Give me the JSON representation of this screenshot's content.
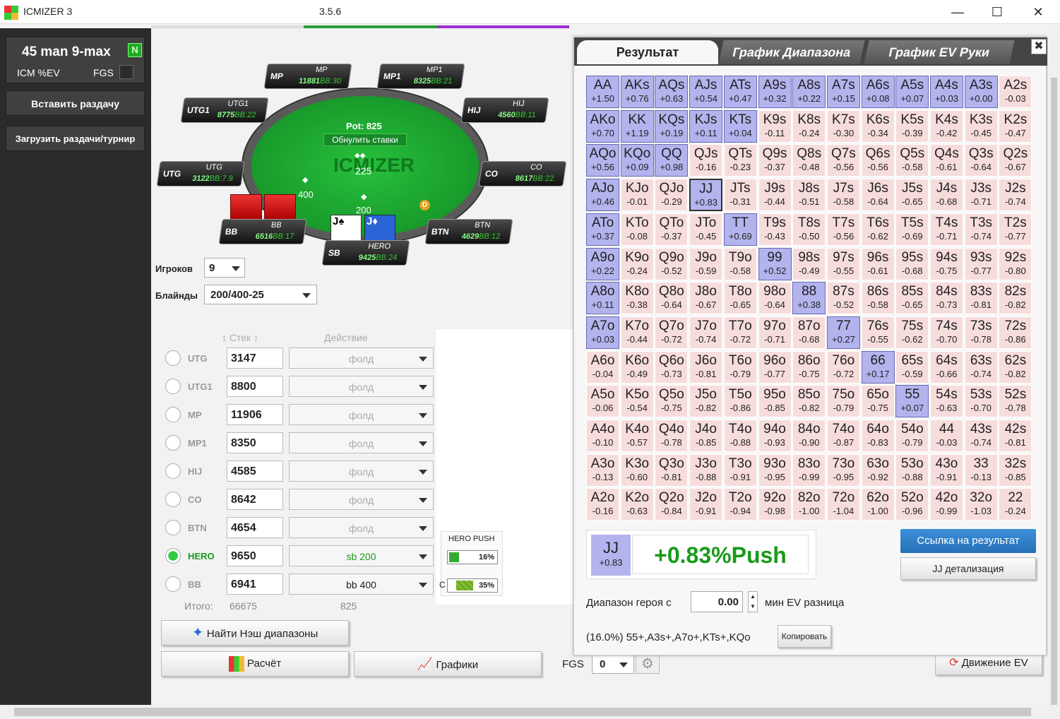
{
  "app": {
    "title": "ICMIZER 3",
    "version": "3.5.6",
    "minimize": "—",
    "maximize": "☐",
    "close": "✕"
  },
  "sidebar": {
    "tournament": "45 man 9-max",
    "tourn_badge": "N",
    "icm_label": "ICM %EV",
    "fgs_label": "FGS",
    "paste_btn": "Вставить раздачу",
    "load_btn": "Загрузить раздачи/турнир"
  },
  "table": {
    "pot": "Pot: 825",
    "reset": "Обнулить ставки",
    "logo": "ICMIZER",
    "center_bet": "225",
    "sb_bet": "200",
    "bb_bet": "400",
    "dealer": "D",
    "seats": [
      {
        "pos": "MP",
        "name": "MP",
        "stack": "11881",
        "bb": "30"
      },
      {
        "pos": "MP1",
        "name": "MP1",
        "stack": "8325",
        "bb": "21"
      },
      {
        "pos": "UTG1",
        "name": "UTG1",
        "stack": "8775",
        "bb": "22"
      },
      {
        "pos": "HIJ",
        "name": "HIJ",
        "stack": "4560",
        "bb": "11"
      },
      {
        "pos": "UTG",
        "name": "UTG",
        "stack": "3122",
        "bb": "7.9"
      },
      {
        "pos": "CO",
        "name": "CO",
        "stack": "8617",
        "bb": "22"
      },
      {
        "pos": "BB",
        "name": "BB",
        "stack": "6516",
        "bb": "17"
      },
      {
        "pos": "BTN",
        "name": "BTN",
        "stack": "4629",
        "bb": "12"
      },
      {
        "pos": "SB",
        "name": "HERO",
        "stack": "9425",
        "bb": "24"
      }
    ],
    "bb_prefix": "BB:",
    "hero_cards": [
      "J♠",
      "J♦"
    ]
  },
  "settings": {
    "players_label": "Игроков",
    "players_value": "9",
    "blinds_label": "Блайнды",
    "blinds_value": "200/400-25"
  },
  "players_header": {
    "stack": "Стек",
    "action": "Действие"
  },
  "players": [
    {
      "pos": "UTG",
      "stack": "3147",
      "action": "фолд"
    },
    {
      "pos": "UTG1",
      "stack": "8800",
      "action": "фолд"
    },
    {
      "pos": "MP",
      "stack": "11906",
      "action": "фолд"
    },
    {
      "pos": "MP1",
      "stack": "8350",
      "action": "фолд"
    },
    {
      "pos": "HIJ",
      "stack": "4585",
      "action": "фолд"
    },
    {
      "pos": "CO",
      "stack": "8642",
      "action": "фолд"
    },
    {
      "pos": "BTN",
      "stack": "4654",
      "action": "фолд"
    },
    {
      "pos": "HERO",
      "stack": "9650",
      "action": "sb 200"
    },
    {
      "pos": "BB",
      "stack": "6941",
      "action": "bb 400"
    }
  ],
  "totals": {
    "label": "Итого:",
    "stack": "66675",
    "action": "825"
  },
  "hero_push": {
    "title": "HERO PUSH",
    "push_pct": "16%",
    "call_label": "C",
    "call_pct": "35%"
  },
  "buttons": {
    "nash": "Найти Нэш диапазоны",
    "calc": "Расчёт",
    "charts": "Графики",
    "fgs_label": "FGS",
    "fgs_value": "0",
    "ev_move": "Движение EV"
  },
  "panel": {
    "tabs": [
      "Результат",
      "График Диапазона",
      "График EV Руки"
    ],
    "close": "✖",
    "selected_hand": {
      "hand": "JJ",
      "ev": "+0.83",
      "result": "+0.83%Push"
    },
    "link_btn": "Ссылка на результат",
    "detail_btn": "JJ детализация",
    "range_label": "Диапазон героя с",
    "range_value": "0.00",
    "range_suffix": "мин EV разница",
    "range_text": "(16.0%) 55+,A3s+,A7o+,KTs+,KQo",
    "copy_btn": "Копировать",
    "grid": [
      [
        [
          "AA",
          "+1.50"
        ],
        [
          "AKs",
          "+0.76"
        ],
        [
          "AQs",
          "+0.63"
        ],
        [
          "AJs",
          "+0.54"
        ],
        [
          "ATs",
          "+0.47"
        ],
        [
          "A9s",
          "+0.32"
        ],
        [
          "A8s",
          "+0.22"
        ],
        [
          "A7s",
          "+0.15"
        ],
        [
          "A6s",
          "+0.08"
        ],
        [
          "A5s",
          "+0.07"
        ],
        [
          "A4s",
          "+0.03"
        ],
        [
          "A3s",
          "+0.00"
        ],
        [
          "A2s",
          "-0.03"
        ]
      ],
      [
        [
          "AKo",
          "+0.70"
        ],
        [
          "KK",
          "+1.19"
        ],
        [
          "KQs",
          "+0.19"
        ],
        [
          "KJs",
          "+0.11"
        ],
        [
          "KTs",
          "+0.04"
        ],
        [
          "K9s",
          "-0.11"
        ],
        [
          "K8s",
          "-0.24"
        ],
        [
          "K7s",
          "-0.30"
        ],
        [
          "K6s",
          "-0.34"
        ],
        [
          "K5s",
          "-0.39"
        ],
        [
          "K4s",
          "-0.42"
        ],
        [
          "K3s",
          "-0.45"
        ],
        [
          "K2s",
          "-0.47"
        ]
      ],
      [
        [
          "AQo",
          "+0.56"
        ],
        [
          "KQo",
          "+0.09"
        ],
        [
          "QQ",
          "+0.98"
        ],
        [
          "QJs",
          "-0.16"
        ],
        [
          "QTs",
          "-0.23"
        ],
        [
          "Q9s",
          "-0.37"
        ],
        [
          "Q8s",
          "-0.48"
        ],
        [
          "Q7s",
          "-0.56"
        ],
        [
          "Q6s",
          "-0.56"
        ],
        [
          "Q5s",
          "-0.58"
        ],
        [
          "Q4s",
          "-0.61"
        ],
        [
          "Q3s",
          "-0.64"
        ],
        [
          "Q2s",
          "-0.67"
        ]
      ],
      [
        [
          "AJo",
          "+0.46"
        ],
        [
          "KJo",
          "-0.01"
        ],
        [
          "QJo",
          "-0.29"
        ],
        [
          "JJ",
          "+0.83"
        ],
        [
          "JTs",
          "-0.31"
        ],
        [
          "J9s",
          "-0.44"
        ],
        [
          "J8s",
          "-0.51"
        ],
        [
          "J7s",
          "-0.58"
        ],
        [
          "J6s",
          "-0.64"
        ],
        [
          "J5s",
          "-0.65"
        ],
        [
          "J4s",
          "-0.68"
        ],
        [
          "J3s",
          "-0.71"
        ],
        [
          "J2s",
          "-0.74"
        ]
      ],
      [
        [
          "ATo",
          "+0.37"
        ],
        [
          "KTo",
          "-0.08"
        ],
        [
          "QTo",
          "-0.37"
        ],
        [
          "JTo",
          "-0.45"
        ],
        [
          "TT",
          "+0.69"
        ],
        [
          "T9s",
          "-0.43"
        ],
        [
          "T8s",
          "-0.50"
        ],
        [
          "T7s",
          "-0.56"
        ],
        [
          "T6s",
          "-0.62"
        ],
        [
          "T5s",
          "-0.69"
        ],
        [
          "T4s",
          "-0.71"
        ],
        [
          "T3s",
          "-0.74"
        ],
        [
          "T2s",
          "-0.77"
        ]
      ],
      [
        [
          "A9o",
          "+0.22"
        ],
        [
          "K9o",
          "-0.24"
        ],
        [
          "Q9o",
          "-0.52"
        ],
        [
          "J9o",
          "-0.59"
        ],
        [
          "T9o",
          "-0.58"
        ],
        [
          "99",
          "+0.52"
        ],
        [
          "98s",
          "-0.49"
        ],
        [
          "97s",
          "-0.55"
        ],
        [
          "96s",
          "-0.61"
        ],
        [
          "95s",
          "-0.68"
        ],
        [
          "94s",
          "-0.75"
        ],
        [
          "93s",
          "-0.77"
        ],
        [
          "92s",
          "-0.80"
        ]
      ],
      [
        [
          "A8o",
          "+0.11"
        ],
        [
          "K8o",
          "-0.38"
        ],
        [
          "Q8o",
          "-0.64"
        ],
        [
          "J8o",
          "-0.67"
        ],
        [
          "T8o",
          "-0.65"
        ],
        [
          "98o",
          "-0.64"
        ],
        [
          "88",
          "+0.38"
        ],
        [
          "87s",
          "-0.52"
        ],
        [
          "86s",
          "-0.58"
        ],
        [
          "85s",
          "-0.65"
        ],
        [
          "84s",
          "-0.73"
        ],
        [
          "83s",
          "-0.81"
        ],
        [
          "82s",
          "-0.82"
        ]
      ],
      [
        [
          "A7o",
          "+0.03"
        ],
        [
          "K7o",
          "-0.44"
        ],
        [
          "Q7o",
          "-0.72"
        ],
        [
          "J7o",
          "-0.74"
        ],
        [
          "T7o",
          "-0.72"
        ],
        [
          "97o",
          "-0.71"
        ],
        [
          "87o",
          "-0.68"
        ],
        [
          "77",
          "+0.27"
        ],
        [
          "76s",
          "-0.55"
        ],
        [
          "75s",
          "-0.62"
        ],
        [
          "74s",
          "-0.70"
        ],
        [
          "73s",
          "-0.78"
        ],
        [
          "72s",
          "-0.86"
        ]
      ],
      [
        [
          "A6o",
          "-0.04"
        ],
        [
          "K6o",
          "-0.49"
        ],
        [
          "Q6o",
          "-0.73"
        ],
        [
          "J6o",
          "-0.81"
        ],
        [
          "T6o",
          "-0.79"
        ],
        [
          "96o",
          "-0.77"
        ],
        [
          "86o",
          "-0.75"
        ],
        [
          "76o",
          "-0.72"
        ],
        [
          "66",
          "+0.17"
        ],
        [
          "65s",
          "-0.59"
        ],
        [
          "64s",
          "-0.66"
        ],
        [
          "63s",
          "-0.74"
        ],
        [
          "62s",
          "-0.82"
        ]
      ],
      [
        [
          "A5o",
          "-0.06"
        ],
        [
          "K5o",
          "-0.54"
        ],
        [
          "Q5o",
          "-0.75"
        ],
        [
          "J5o",
          "-0.82"
        ],
        [
          "T5o",
          "-0.86"
        ],
        [
          "95o",
          "-0.85"
        ],
        [
          "85o",
          "-0.82"
        ],
        [
          "75o",
          "-0.79"
        ],
        [
          "65o",
          "-0.75"
        ],
        [
          "55",
          "+0.07"
        ],
        [
          "54s",
          "-0.63"
        ],
        [
          "53s",
          "-0.70"
        ],
        [
          "52s",
          "-0.78"
        ]
      ],
      [
        [
          "A4o",
          "-0.10"
        ],
        [
          "K4o",
          "-0.57"
        ],
        [
          "Q4o",
          "-0.78"
        ],
        [
          "J4o",
          "-0.85"
        ],
        [
          "T4o",
          "-0.88"
        ],
        [
          "94o",
          "-0.93"
        ],
        [
          "84o",
          "-0.90"
        ],
        [
          "74o",
          "-0.87"
        ],
        [
          "64o",
          "-0.83"
        ],
        [
          "54o",
          "-0.79"
        ],
        [
          "44",
          "-0.03"
        ],
        [
          "43s",
          "-0.74"
        ],
        [
          "42s",
          "-0.81"
        ]
      ],
      [
        [
          "A3o",
          "-0.13"
        ],
        [
          "K3o",
          "-0.60"
        ],
        [
          "Q3o",
          "-0.81"
        ],
        [
          "J3o",
          "-0.88"
        ],
        [
          "T3o",
          "-0.91"
        ],
        [
          "93o",
          "-0.95"
        ],
        [
          "83o",
          "-0.99"
        ],
        [
          "73o",
          "-0.95"
        ],
        [
          "63o",
          "-0.92"
        ],
        [
          "53o",
          "-0.88"
        ],
        [
          "43o",
          "-0.91"
        ],
        [
          "33",
          "-0.13"
        ],
        [
          "32s",
          "-0.85"
        ]
      ],
      [
        [
          "A2o",
          "-0.16"
        ],
        [
          "K2o",
          "-0.63"
        ],
        [
          "Q2o",
          "-0.84"
        ],
        [
          "J2o",
          "-0.91"
        ],
        [
          "T2o",
          "-0.94"
        ],
        [
          "92o",
          "-0.98"
        ],
        [
          "82o",
          "-1.00"
        ],
        [
          "72o",
          "-1.04"
        ],
        [
          "62o",
          "-1.00"
        ],
        [
          "52o",
          "-0.96"
        ],
        [
          "42o",
          "-0.99"
        ],
        [
          "32o",
          "-1.03"
        ],
        [
          "22",
          "-0.24"
        ]
      ]
    ],
    "push_range": [
      [
        1,
        1,
        1,
        1,
        1,
        1,
        1,
        1,
        1,
        1,
        1,
        1,
        0
      ],
      [
        1,
        1,
        1,
        1,
        1,
        0,
        0,
        0,
        0,
        0,
        0,
        0,
        0
      ],
      [
        1,
        1,
        1,
        0,
        0,
        0,
        0,
        0,
        0,
        0,
        0,
        0,
        0
      ],
      [
        1,
        0,
        0,
        1,
        0,
        0,
        0,
        0,
        0,
        0,
        0,
        0,
        0
      ],
      [
        1,
        0,
        0,
        0,
        1,
        0,
        0,
        0,
        0,
        0,
        0,
        0,
        0
      ],
      [
        1,
        0,
        0,
        0,
        0,
        1,
        0,
        0,
        0,
        0,
        0,
        0,
        0
      ],
      [
        1,
        0,
        0,
        0,
        0,
        0,
        1,
        0,
        0,
        0,
        0,
        0,
        0
      ],
      [
        1,
        0,
        0,
        0,
        0,
        0,
        0,
        1,
        0,
        0,
        0,
        0,
        0
      ],
      [
        0,
        0,
        0,
        0,
        0,
        0,
        0,
        0,
        1,
        0,
        0,
        0,
        0
      ],
      [
        0,
        0,
        0,
        0,
        0,
        0,
        0,
        0,
        0,
        1,
        0,
        0,
        0
      ],
      [
        0,
        0,
        0,
        0,
        0,
        0,
        0,
        0,
        0,
        0,
        0,
        0,
        0
      ],
      [
        0,
        0,
        0,
        0,
        0,
        0,
        0,
        0,
        0,
        0,
        0,
        0,
        0
      ],
      [
        0,
        0,
        0,
        0,
        0,
        0,
        0,
        0,
        0,
        0,
        0,
        0,
        0
      ]
    ]
  },
  "colors": {
    "felt": "#1fa332",
    "push": "#b3b3ee",
    "fold": "#f7dcdc",
    "accent": "#2770b8",
    "green": "#1a9a1a"
  }
}
